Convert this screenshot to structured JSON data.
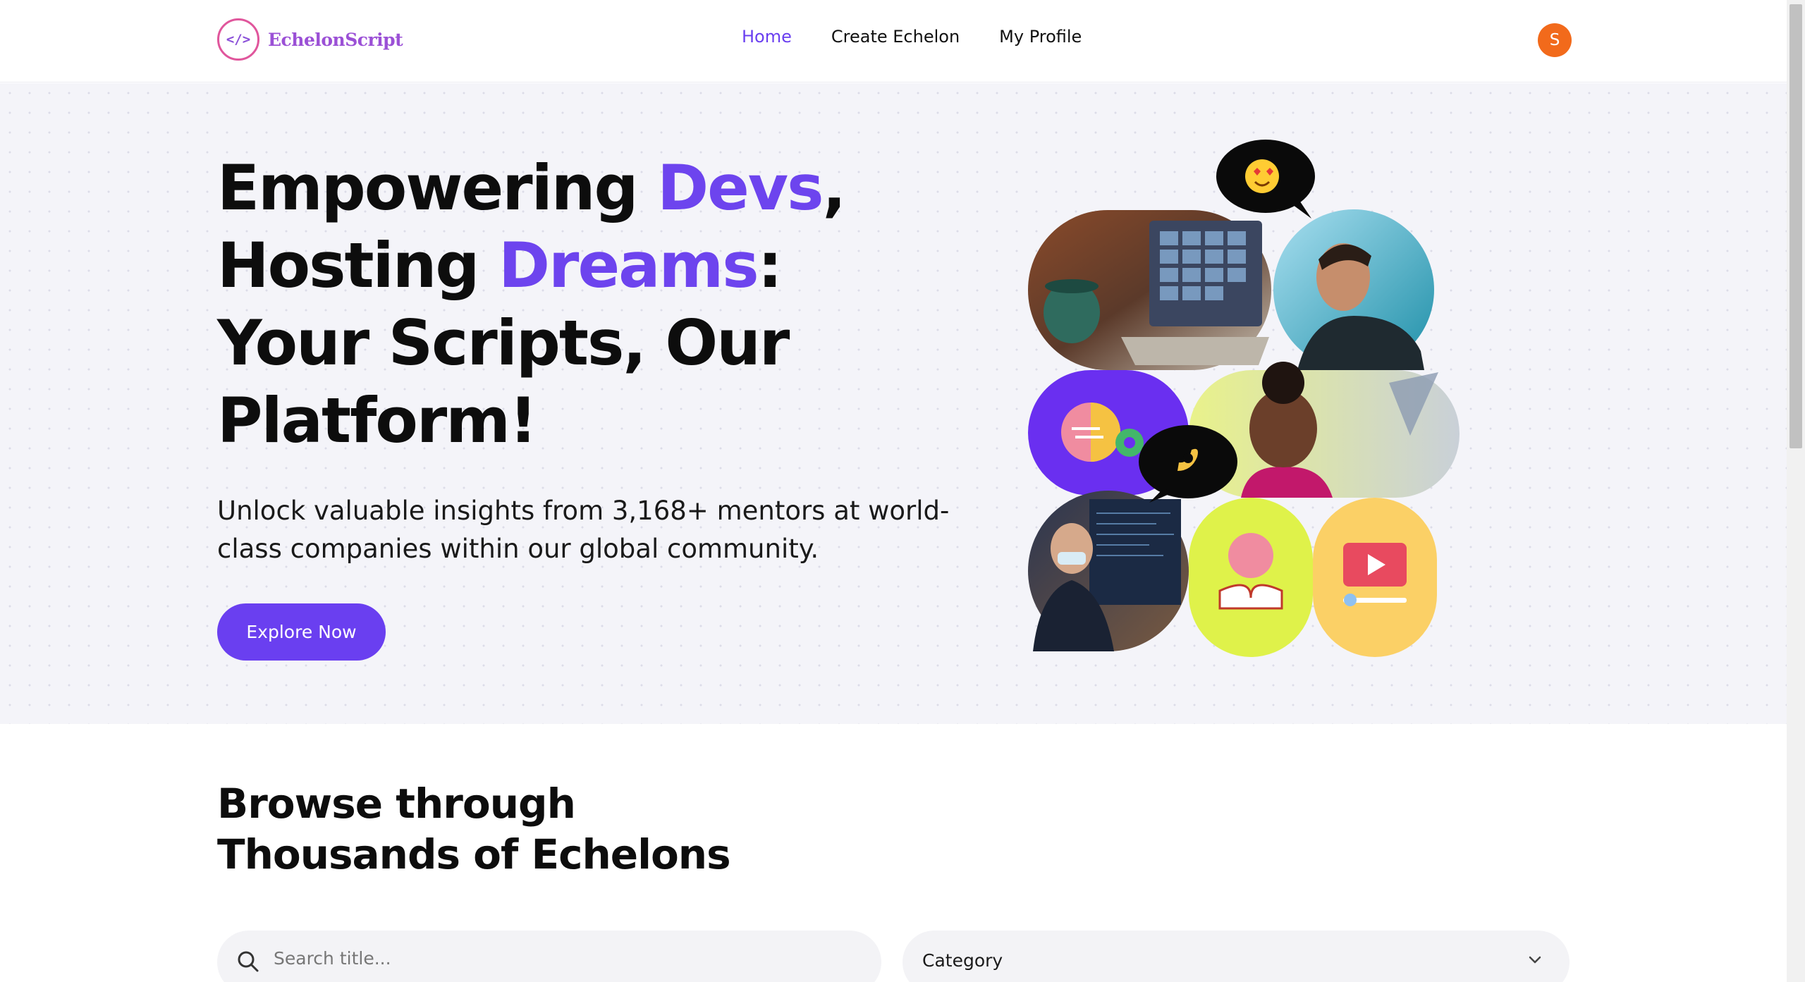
{
  "header": {
    "logo_symbol": "</>",
    "logo_text": "EchelonScript",
    "nav": [
      {
        "label": "Home",
        "active": true
      },
      {
        "label": "Create Echelon",
        "active": false
      },
      {
        "label": "My Profile",
        "active": false
      }
    ],
    "avatar_initial": "S"
  },
  "hero": {
    "title_parts": {
      "l1_a": "Empowering ",
      "l1_accent": "Devs",
      "l1_b": ",",
      "l2_a": "Hosting ",
      "l2_accent": "Dreams",
      "l2_b": ":",
      "l3": "Your Scripts, Our",
      "l4": "Platform!"
    },
    "subtitle": "Unlock valuable insights from 3,168+ mentors at world-class companies within our global community.",
    "cta_label": "Explore Now",
    "collage_items": [
      "laptop-video-call-photo",
      "smiling-man-photo",
      "brain-gear-icon",
      "laughing-woman-photo",
      "presenter-photo",
      "brain-book-icon",
      "video-play-icon",
      "heart-eyes-emoji",
      "ok-hand-emoji"
    ]
  },
  "browse": {
    "title_line1": "Browse through",
    "title_line2": "Thousands of Echelons",
    "search_placeholder": "Search title...",
    "category_label": "Category"
  },
  "colors": {
    "brand": "#6a3ff0",
    "accent_text": "#6d44ee",
    "avatar": "#f26a1b",
    "hero_bg": "#f4f4f9"
  }
}
